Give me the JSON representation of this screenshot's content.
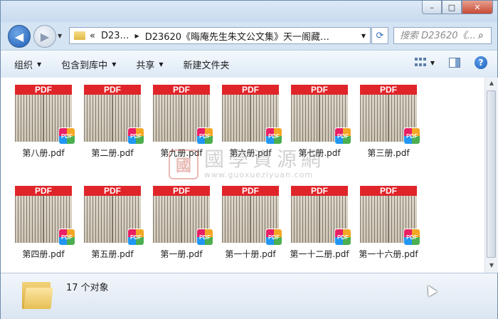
{
  "window": {
    "minimize_glyph": "–",
    "maximize_glyph": "□",
    "close_glyph": "✕"
  },
  "navigation": {
    "back_glyph": "◀",
    "forward_glyph": "▶",
    "dropdown_glyph": "▼"
  },
  "address": {
    "overflow": "«",
    "crumbs": [
      "D23…",
      "D23620《晦庵先生朱文公文集》天一阁藏…"
    ],
    "separator": "▶",
    "dropdown_glyph": "▼",
    "refresh_glyph": "⟳"
  },
  "search": {
    "placeholder": "搜索 D23620《...",
    "icon_glyph": "⌕"
  },
  "toolbar": {
    "organize": "组织",
    "include_library": "包含到库中",
    "share": "共享",
    "new_folder": "新建文件夹",
    "dropdown_glyph": "▼",
    "help_glyph": "?"
  },
  "files": [
    {
      "name": "第八册.pdf",
      "band": "PDF",
      "badge": "PDF"
    },
    {
      "name": "第二册.pdf",
      "band": "PDF",
      "badge": "PDF"
    },
    {
      "name": "第九册.pdf",
      "band": "PDF",
      "badge": "PDF"
    },
    {
      "name": "第六册.pdf",
      "band": "PDF",
      "badge": "PDF"
    },
    {
      "name": "第七册.pdf",
      "band": "PDF",
      "badge": "PDF"
    },
    {
      "name": "第三册.pdf",
      "band": "PDF",
      "badge": "PDF"
    },
    {
      "name": "第四册.pdf",
      "band": "PDF",
      "badge": "PDF"
    },
    {
      "name": "第五册.pdf",
      "band": "PDF",
      "badge": "PDF"
    },
    {
      "name": "第一册.pdf",
      "band": "PDF",
      "badge": "PDF"
    },
    {
      "name": "第一十册.pdf",
      "band": "PDF",
      "badge": "PDF"
    },
    {
      "name": "第一十二册.pdf",
      "band": "PDF",
      "badge": "PDF"
    },
    {
      "name": "第一十六册.pdf",
      "band": "PDF",
      "badge": "PDF"
    }
  ],
  "watermark": {
    "seal": "國",
    "title": "國學資源網",
    "url": "www.guoxueziyuan.com"
  },
  "scrollbar": {
    "up_glyph": "▲",
    "down_glyph": "▼"
  },
  "status": {
    "item_count": "17 个对象"
  }
}
